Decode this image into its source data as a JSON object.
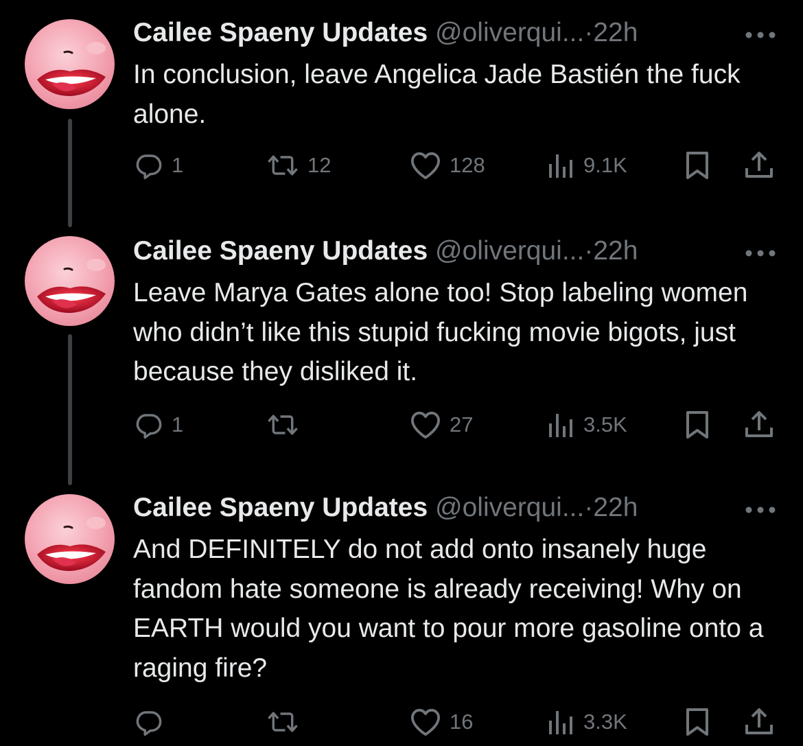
{
  "tweets": [
    {
      "author_name": "Cailee Spaeny Updates",
      "handle": "@oliverqui...",
      "separator": "·",
      "time": "22h",
      "text": "In conclusion, leave Angelica Jade Bastién the fuck alone.",
      "replies": "1",
      "retweets": "12",
      "likes": "128",
      "views": "9.1K"
    },
    {
      "author_name": "Cailee Spaeny Updates",
      "handle": "@oliverqui...",
      "separator": "·",
      "time": "22h",
      "text": "Leave Marya Gates alone too! Stop labeling women who didn’t like this stupid fucking movie bigots, just because they disliked it.",
      "replies": "1",
      "retweets": "",
      "likes": "27",
      "views": "3.5K"
    },
    {
      "author_name": "Cailee Spaeny Updates",
      "handle": "@oliverqui...",
      "separator": "·",
      "time": "22h",
      "text": "And DEFINITELY do not add onto insanely huge fandom hate someone is already receiving! Why on EARTH would you want to pour more gasoline onto a raging fire?",
      "replies": "",
      "retweets": "",
      "likes": "16",
      "views": "3.3K"
    }
  ],
  "icons": {
    "reply": "reply-icon",
    "retweet": "retweet-icon",
    "like": "heart-icon",
    "views": "views-icon",
    "bookmark": "bookmark-icon",
    "share": "share-icon",
    "more": "more-dots-icon",
    "avatar": "lips-avatar"
  },
  "colors": {
    "background": "#000000",
    "text_primary": "#e7e9ea",
    "text_secondary": "#71767b",
    "thread_line": "#3e4144",
    "avatar_pink": "#f4a6b4",
    "lips_red": "#c8102e"
  }
}
